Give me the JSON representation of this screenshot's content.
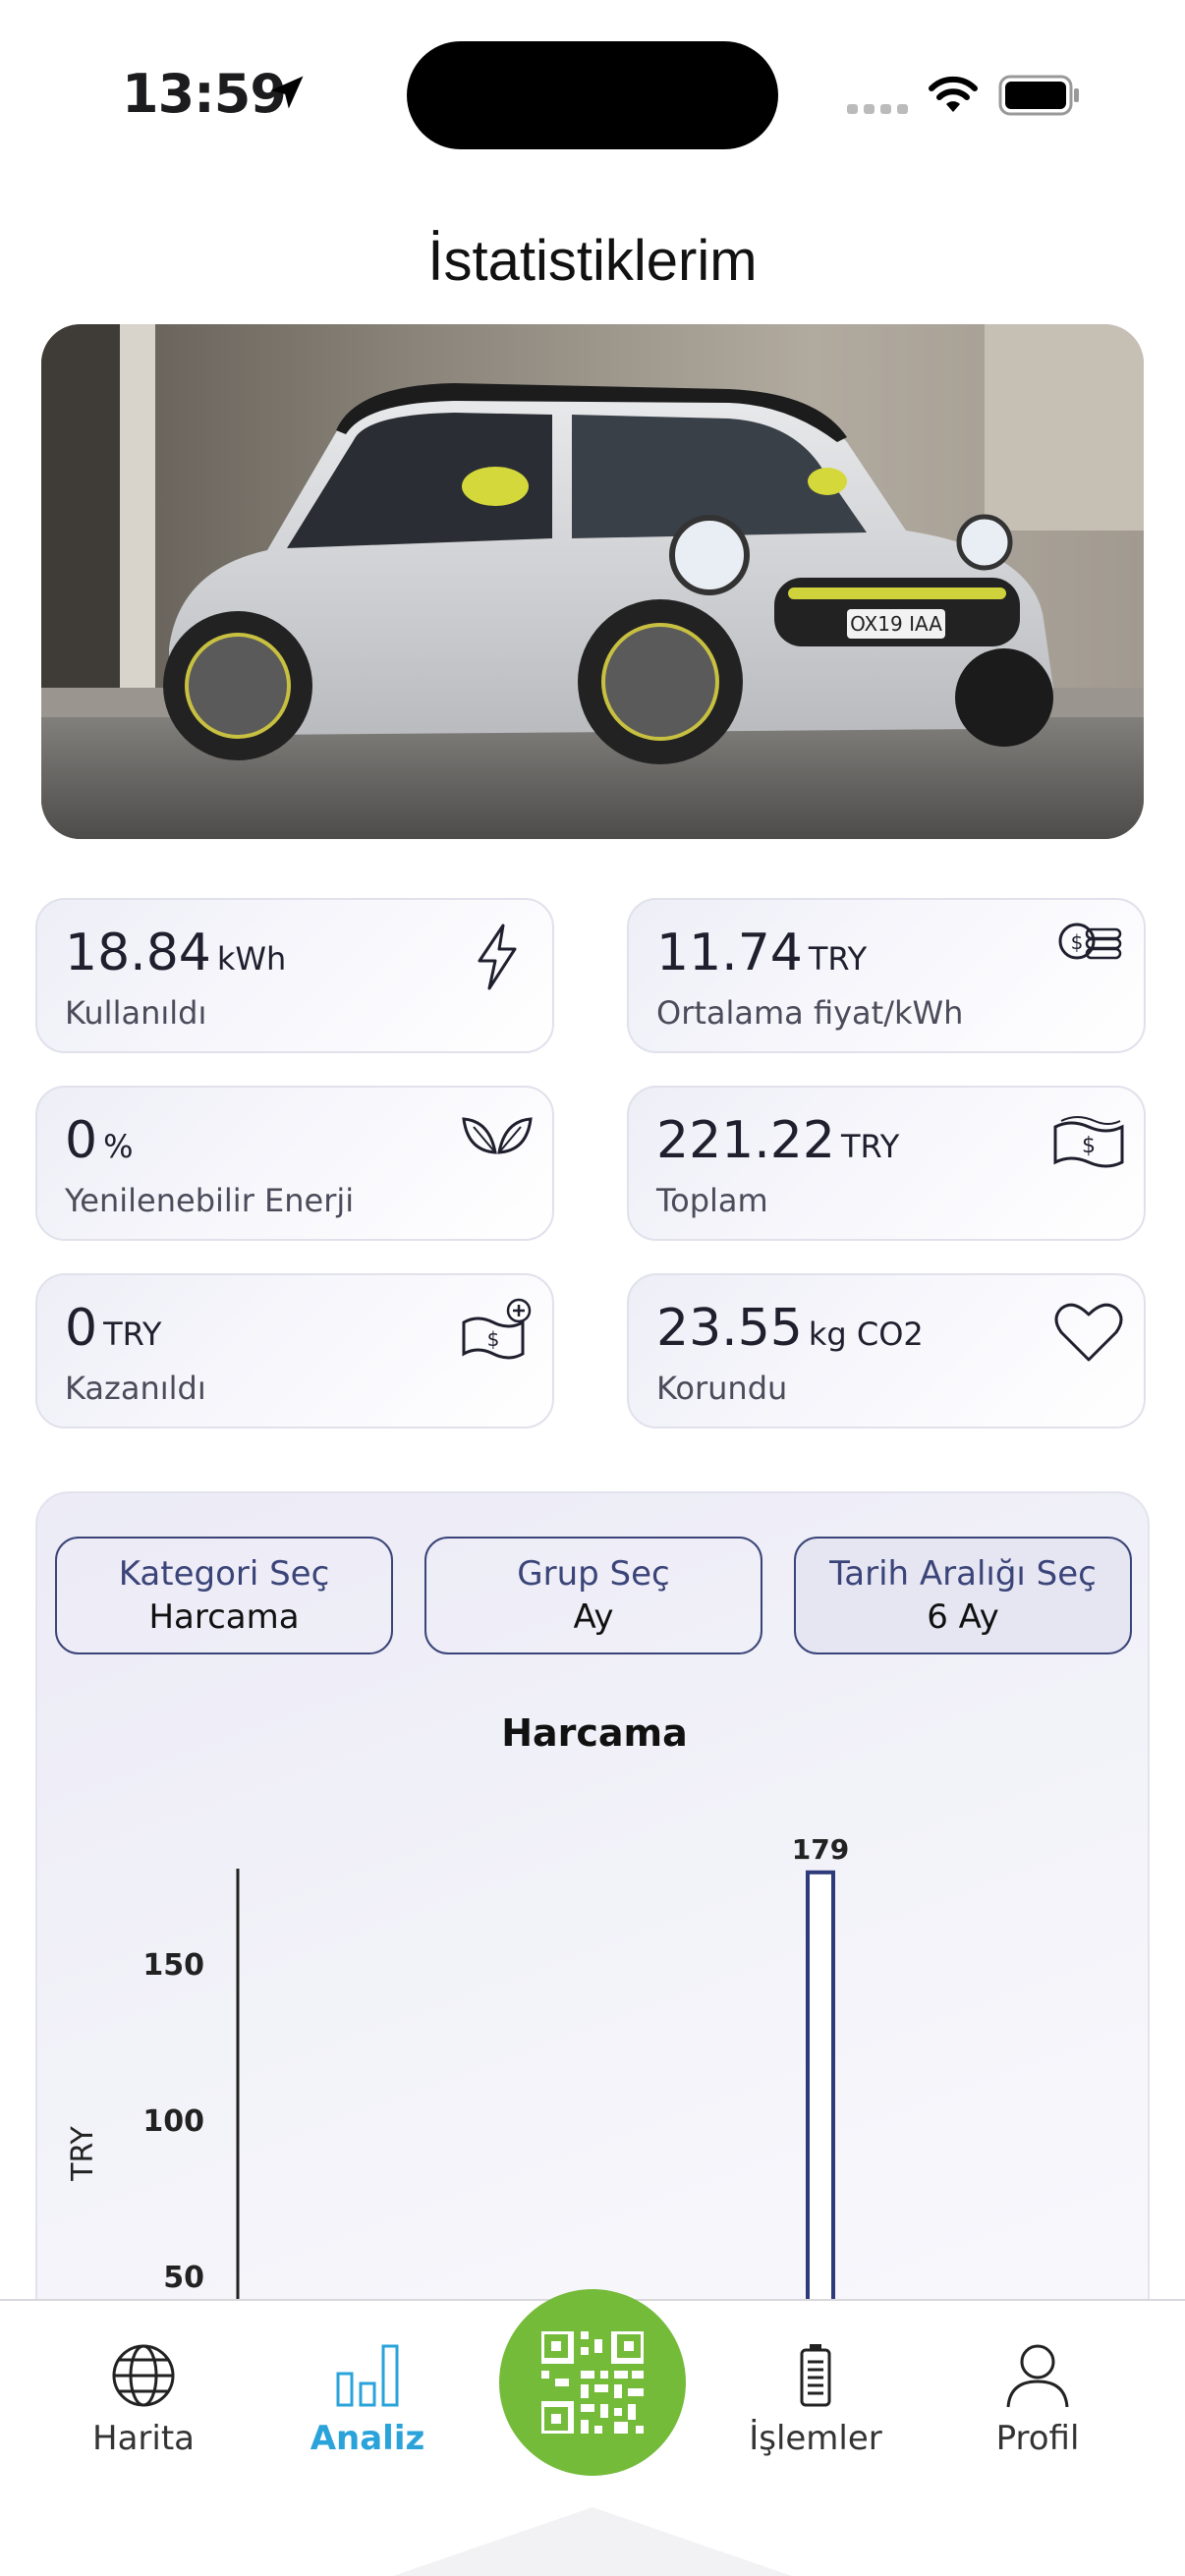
{
  "status_bar": {
    "time": "13:59"
  },
  "header": {
    "title": "İstatistiklerim"
  },
  "stats": [
    {
      "value": "18.84",
      "unit": "kWh",
      "label": "Kullanıldı",
      "icon": "lightning-icon"
    },
    {
      "value": "11.74",
      "unit": "TRY",
      "label": "Ortalama fiyat/kWh",
      "icon": "coins-icon"
    },
    {
      "value": "0",
      "unit": "%",
      "label": "Yenilenebilir Enerji",
      "icon": "leaf-icon"
    },
    {
      "value": "221.22",
      "unit": "TRY",
      "label": "Toplam",
      "icon": "banknote-icon"
    },
    {
      "value": "0",
      "unit": "TRY",
      "label": "Kazanıldı",
      "icon": "banknote-add-icon"
    },
    {
      "value": "23.55",
      "unit": "kg CO2",
      "label": "Korundu",
      "icon": "heart-icon"
    }
  ],
  "filters": [
    {
      "title": "Kategori Seç",
      "value": "Harcama"
    },
    {
      "title": "Grup Seç",
      "value": "Ay"
    },
    {
      "title": "Tarih Aralığı Seç",
      "value": "6 Ay"
    }
  ],
  "chart_data": {
    "type": "bar",
    "title": "Harcama",
    "ylabel": "TRY",
    "yticks": [
      "150",
      "100",
      "50"
    ],
    "bar_value_labels": [
      "179"
    ],
    "values": [
      179
    ],
    "color": "#2e3a7a"
  },
  "tabs": [
    {
      "label": "Harita",
      "icon": "globe-icon"
    },
    {
      "label": "Analiz",
      "icon": "bar-chart-icon",
      "active": true
    },
    {
      "label": "İşlemler",
      "icon": "battery-icon"
    },
    {
      "label": "Profil",
      "icon": "person-icon"
    }
  ],
  "colors": {
    "accent": "#2aa3da",
    "qr_button": "#74bb3a",
    "filter_text": "#3a4478"
  }
}
